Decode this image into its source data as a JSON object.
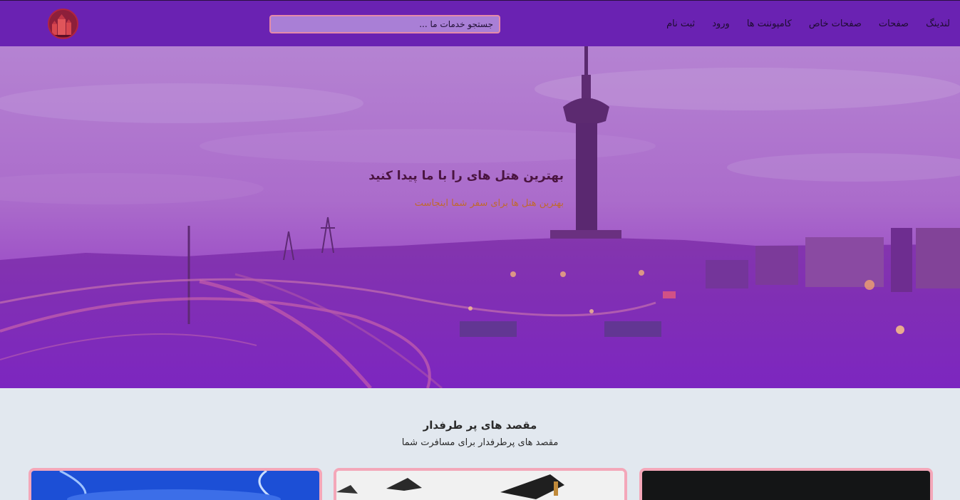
{
  "header": {
    "nav": [
      {
        "label": "لندینگ"
      },
      {
        "label": "صفحات"
      },
      {
        "label": "صفحات خاص"
      },
      {
        "label": "کامپوننت ها"
      },
      {
        "label": "ورود"
      },
      {
        "label": "ثبت نام"
      }
    ],
    "search": {
      "placeholder": "جستجو خدمات ما ..."
    },
    "logo_icon": "hotel-logo-icon"
  },
  "hero": {
    "title": "بهترین هتل های را با ما پیدا کنید",
    "subtitle": "بهترین هتل ها برای سفر شما اینجاست"
  },
  "destinations": {
    "title": "مقصد های پر طرفدار",
    "subtitle": "مقصد های پرطرفدار برای مسافرت شما"
  },
  "colors": {
    "navbar": "#6a22b2",
    "hero_overlay": "#9a4bc4",
    "card_border": "#f4a7b9",
    "page_bg": "#e2e8ef"
  }
}
